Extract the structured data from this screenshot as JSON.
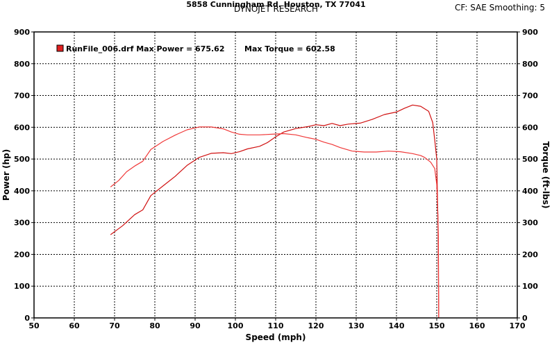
{
  "header": {
    "title": "DYNOJET RESEARCH",
    "correction_info": "CF: SAE  Smoothing: 5"
  },
  "footer": {
    "address": "5858 Cunningham Rd. Houston, TX 77041"
  },
  "legend": {
    "run_label": "RunFile_006.drf Max Power = 675.62",
    "torque_label": "Max Torque = 602.58",
    "swatch_color": "#e02020"
  },
  "chart_data": {
    "type": "line",
    "xlabel": "Speed (mph)",
    "ylabel": "Power (hp)",
    "y2label": "Torque (ft-lbs)",
    "xlim": [
      50,
      170
    ],
    "ylim": [
      0,
      900
    ],
    "y2lim": [
      0,
      900
    ],
    "x_ticks": [
      50,
      60,
      70,
      80,
      90,
      100,
      110,
      120,
      130,
      140,
      150,
      160,
      170
    ],
    "y_ticks": [
      0,
      100,
      200,
      300,
      400,
      500,
      600,
      700,
      800,
      900
    ],
    "grid": true,
    "series": [
      {
        "name": "Power",
        "color": "#d01010",
        "points": [
          [
            69,
            262
          ],
          [
            72,
            290
          ],
          [
            75,
            325
          ],
          [
            77,
            340
          ],
          [
            79,
            385
          ],
          [
            82,
            415
          ],
          [
            85,
            445
          ],
          [
            88,
            480
          ],
          [
            91,
            505
          ],
          [
            94,
            518
          ],
          [
            97,
            520
          ],
          [
            99,
            517
          ],
          [
            101,
            523
          ],
          [
            103,
            532
          ],
          [
            106,
            540
          ],
          [
            108,
            552
          ],
          [
            110,
            570
          ],
          [
            112,
            585
          ],
          [
            115,
            596
          ],
          [
            118,
            602
          ],
          [
            120,
            608
          ],
          [
            122,
            605
          ],
          [
            124,
            612
          ],
          [
            126,
            605
          ],
          [
            128,
            610
          ],
          [
            131,
            613
          ],
          [
            134,
            625
          ],
          [
            137,
            640
          ],
          [
            140,
            648
          ],
          [
            142,
            660
          ],
          [
            144,
            670
          ],
          [
            146,
            666
          ],
          [
            148,
            650
          ],
          [
            149,
            615
          ],
          [
            149.5,
            560
          ],
          [
            150,
            500
          ],
          [
            150.2,
            360
          ],
          [
            150.4,
            260
          ],
          [
            150.5,
            0
          ]
        ]
      },
      {
        "name": "Torque",
        "color": "#f03838",
        "points": [
          [
            69,
            412
          ],
          [
            71,
            432
          ],
          [
            73,
            460
          ],
          [
            75,
            478
          ],
          [
            77,
            493
          ],
          [
            79,
            530
          ],
          [
            82,
            555
          ],
          [
            85,
            575
          ],
          [
            88,
            592
          ],
          [
            91,
            601
          ],
          [
            94,
            601
          ],
          [
            97,
            595
          ],
          [
            99,
            585
          ],
          [
            101,
            578
          ],
          [
            103,
            576
          ],
          [
            106,
            576
          ],
          [
            109,
            578
          ],
          [
            112,
            580
          ],
          [
            115,
            576
          ],
          [
            118,
            567
          ],
          [
            120,
            562
          ],
          [
            122,
            553
          ],
          [
            124,
            546
          ],
          [
            126,
            536
          ],
          [
            129,
            525
          ],
          [
            132,
            522
          ],
          [
            135,
            522
          ],
          [
            138,
            525
          ],
          [
            141,
            523
          ],
          [
            144,
            517
          ],
          [
            146,
            511
          ],
          [
            147,
            505
          ],
          [
            148.5,
            490
          ],
          [
            149.5,
            470
          ],
          [
            150,
            420
          ],
          [
            150.3,
            320
          ],
          [
            150.5,
            0
          ]
        ]
      }
    ]
  }
}
